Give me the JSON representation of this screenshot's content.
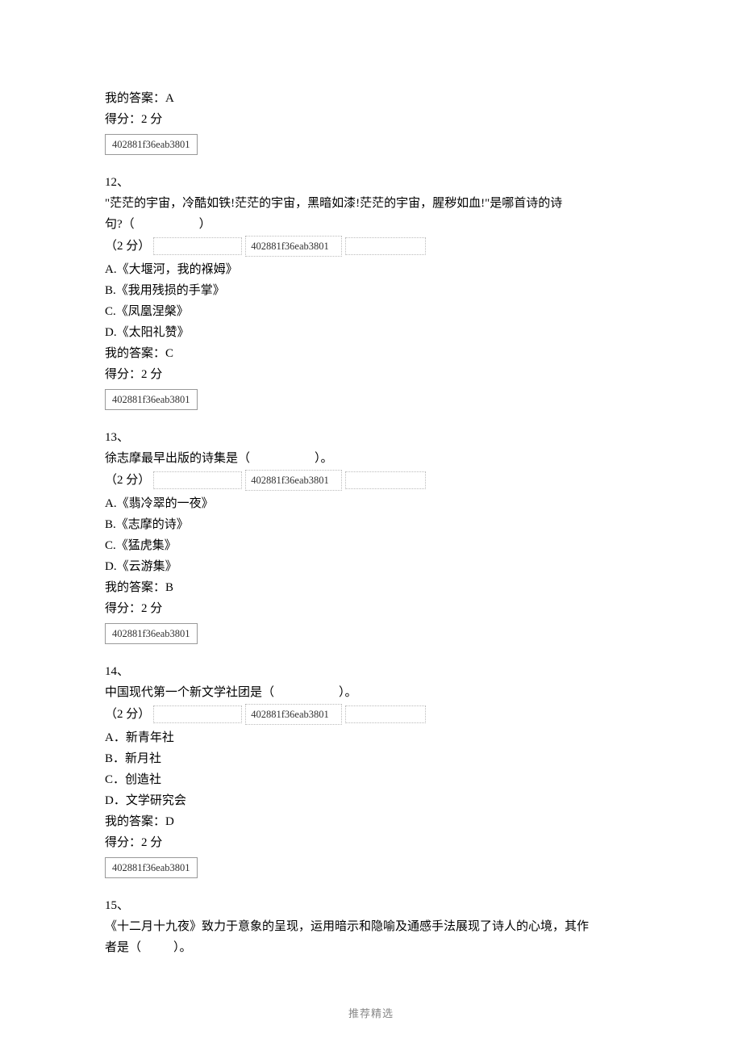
{
  "leadin": {
    "my_answer_label": "我的答案：",
    "my_answer_value": "A",
    "score_label": "得分：",
    "score_value": "2 分",
    "code": "402881f36eab3801"
  },
  "q12": {
    "number": "12、",
    "stem1": "\"茫茫的宇宙，冷酷如铁!茫茫的宇宙，黑暗如漆!茫茫的宇宙，腥秽如血!\"是哪首诗的诗",
    "stem2": "句?（",
    "stem2b": "）",
    "points": "（2 分）",
    "code_mid": "402881f36eab3801",
    "optA": "A.《大堰河，我的褓姆》",
    "optB": "B.《我用残损的手掌》",
    "optC": "C.《凤凰涅槃》",
    "optD": "D.《太阳礼赞》",
    "my_answer_label": "我的答案：",
    "my_answer_value": "C",
    "score_label": "得分：",
    "score_value": "2 分",
    "code": "402881f36eab3801"
  },
  "q13": {
    "number": "13、",
    "stem": "徐志摩最早出版的诗集是（",
    "stem_b": "）。",
    "points": "（2 分）",
    "code_mid": "402881f36eab3801",
    "optA": "A.《翡冷翠的一夜》",
    "optB": "B.《志摩的诗》",
    "optC": "C.《猛虎集》",
    "optD": "D.《云游集》",
    "my_answer_label": "我的答案：",
    "my_answer_value": "B",
    "score_label": "得分：",
    "score_value": "2 分",
    "code": "402881f36eab3801"
  },
  "q14": {
    "number": "14、",
    "stem": "中国现代第一个新文学社团是（",
    "stem_b": "）。",
    "points": "（2 分）",
    "code_mid": "402881f36eab3801",
    "optA": "A．新青年社",
    "optB": "B．新月社",
    "optC": "C．创造社",
    "optD": "D．文学研究会",
    "my_answer_label": "我的答案：",
    "my_answer_value": "D",
    "score_label": "得分：",
    "score_value": "2 分",
    "code": "402881f36eab3801"
  },
  "q15": {
    "number": "15、",
    "stem1": "《十二月十九夜》致力于意象的呈现，运用暗示和隐喻及通感手法展现了诗人的心境，其作",
    "stem2": "者是（",
    "stem2b": "）。"
  },
  "footer": "推荐精选"
}
